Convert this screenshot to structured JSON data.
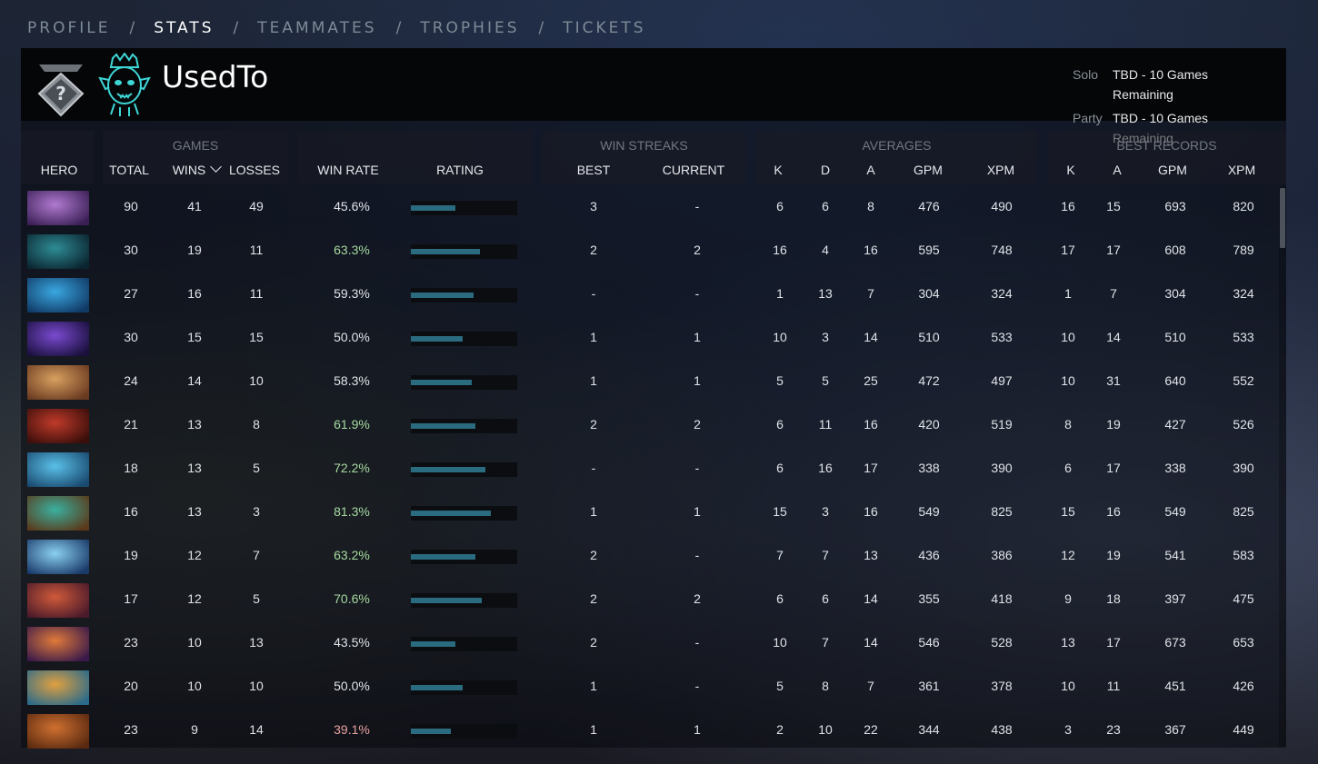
{
  "nav": {
    "tabs": [
      {
        "label": "PROFILE"
      },
      {
        "label": "STATS"
      },
      {
        "label": "TEAMMATES"
      },
      {
        "label": "TROPHIES"
      },
      {
        "label": "TICKETS"
      }
    ],
    "separator": "/",
    "active": "STATS"
  },
  "profile": {
    "username": "UsedTo",
    "rank_icon": "uncalibrated-rank-icon",
    "avatar_icon": "tribal-mask-avatar-icon",
    "mmr": [
      {
        "label": "Solo",
        "value": "TBD - 10 Games Remaining"
      },
      {
        "label": "Party",
        "value": "TBD - 10 Games Remaining"
      }
    ]
  },
  "headers": {
    "groups": {
      "games": "GAMES",
      "win_streaks": "WIN STREAKS",
      "averages": "AVERAGES",
      "best_records": "BEST RECORDS"
    },
    "columns": {
      "hero": "HERO",
      "total": "TOTAL",
      "wins": "WINS",
      "losses": "LOSSES",
      "win_rate": "WIN RATE",
      "rating": "RATING",
      "best": "BEST",
      "current": "CURRENT",
      "avg_k": "K",
      "avg_d": "D",
      "avg_a": "A",
      "avg_gpm": "GPM",
      "avg_xpm": "XPM",
      "best_k": "K",
      "best_a": "A",
      "best_gpm": "GPM",
      "best_xpm": "XPM"
    },
    "sort_icon": "chevron-down-icon"
  },
  "colors": {
    "win_good": "#a6d9a0",
    "win_neutral": "#dfe3e8",
    "win_bad": "#e8a0a0",
    "rating_bar": "#2b6b7f",
    "accent": "#ffffff"
  },
  "rows": [
    {
      "c1": "#b07ad0",
      "c2": "#3a1f55",
      "total": "90",
      "wins": "41",
      "losses": "49",
      "win_rate": "45.6%",
      "tone": "neutral",
      "rating": 0.42,
      "best": "3",
      "current": "-",
      "k": "6",
      "d": "6",
      "a": "8",
      "gpm": "476",
      "xpm": "490",
      "bk": "16",
      "ba": "15",
      "bgpm": "693",
      "bxpm": "820"
    },
    {
      "c1": "#2e8c95",
      "c2": "#0b2530",
      "total": "30",
      "wins": "19",
      "losses": "11",
      "win_rate": "63.3%",
      "tone": "good",
      "rating": 0.65,
      "best": "2",
      "current": "2",
      "k": "16",
      "d": "4",
      "a": "16",
      "gpm": "595",
      "xpm": "748",
      "bk": "17",
      "ba": "17",
      "bgpm": "608",
      "bxpm": "789"
    },
    {
      "c1": "#3aa7e0",
      "c2": "#103a66",
      "total": "27",
      "wins": "16",
      "losses": "11",
      "win_rate": "59.3%",
      "tone": "neutral",
      "rating": 0.59,
      "best": "-",
      "current": "-",
      "k": "1",
      "d": "13",
      "a": "7",
      "gpm": "304",
      "xpm": "324",
      "bk": "1",
      "ba": "7",
      "bgpm": "304",
      "bxpm": "324"
    },
    {
      "c1": "#7a4ad0",
      "c2": "#1a103d",
      "total": "30",
      "wins": "15",
      "losses": "15",
      "win_rate": "50.0%",
      "tone": "neutral",
      "rating": 0.49,
      "best": "1",
      "current": "1",
      "k": "10",
      "d": "3",
      "a": "14",
      "gpm": "510",
      "xpm": "533",
      "bk": "10",
      "ba": "14",
      "bgpm": "510",
      "bxpm": "533"
    },
    {
      "c1": "#d8a060",
      "c2": "#6a3a20",
      "total": "24",
      "wins": "14",
      "losses": "10",
      "win_rate": "58.3%",
      "tone": "neutral",
      "rating": 0.57,
      "best": "1",
      "current": "1",
      "k": "5",
      "d": "5",
      "a": "25",
      "gpm": "472",
      "xpm": "497",
      "bk": "10",
      "ba": "31",
      "bgpm": "640",
      "bxpm": "552"
    },
    {
      "c1": "#c03a2a",
      "c2": "#3a0e0a",
      "total": "21",
      "wins": "13",
      "losses": "8",
      "win_rate": "61.9%",
      "tone": "good",
      "rating": 0.61,
      "best": "2",
      "current": "2",
      "k": "6",
      "d": "11",
      "a": "16",
      "gpm": "420",
      "xpm": "519",
      "bk": "8",
      "ba": "19",
      "bgpm": "427",
      "bxpm": "526"
    },
    {
      "c1": "#5ac0e8",
      "c2": "#1a4a70",
      "total": "18",
      "wins": "13",
      "losses": "5",
      "win_rate": "72.2%",
      "tone": "good",
      "rating": 0.7,
      "best": "-",
      "current": "-",
      "k": "6",
      "d": "16",
      "a": "17",
      "gpm": "338",
      "xpm": "390",
      "bk": "6",
      "ba": "17",
      "bgpm": "338",
      "bxpm": "390"
    },
    {
      "c1": "#3ab0a0",
      "c2": "#5a3a1a",
      "total": "16",
      "wins": "13",
      "losses": "3",
      "win_rate": "81.3%",
      "tone": "good",
      "rating": 0.75,
      "best": "1",
      "current": "1",
      "k": "15",
      "d": "3",
      "a": "16",
      "gpm": "549",
      "xpm": "825",
      "bk": "15",
      "ba": "16",
      "bgpm": "549",
      "bxpm": "825"
    },
    {
      "c1": "#8ad0f0",
      "c2": "#1a3a6a",
      "total": "19",
      "wins": "12",
      "losses": "7",
      "win_rate": "63.2%",
      "tone": "good",
      "rating": 0.61,
      "best": "2",
      "current": "-",
      "k": "7",
      "d": "7",
      "a": "13",
      "gpm": "436",
      "xpm": "386",
      "bk": "12",
      "ba": "19",
      "bgpm": "541",
      "bxpm": "583"
    },
    {
      "c1": "#d05a3a",
      "c2": "#4a1a2a",
      "total": "17",
      "wins": "12",
      "losses": "5",
      "win_rate": "70.6%",
      "tone": "good",
      "rating": 0.67,
      "best": "2",
      "current": "2",
      "k": "6",
      "d": "6",
      "a": "14",
      "gpm": "355",
      "xpm": "418",
      "bk": "9",
      "ba": "18",
      "bgpm": "397",
      "bxpm": "475"
    },
    {
      "c1": "#e07a3a",
      "c2": "#3a1a4a",
      "total": "23",
      "wins": "10",
      "losses": "13",
      "win_rate": "43.5%",
      "tone": "neutral",
      "rating": 0.42,
      "best": "2",
      "current": "-",
      "k": "10",
      "d": "7",
      "a": "14",
      "gpm": "546",
      "xpm": "528",
      "bk": "13",
      "ba": "17",
      "bgpm": "673",
      "bxpm": "653"
    },
    {
      "c1": "#e0a040",
      "c2": "#2a6a8a",
      "total": "20",
      "wins": "10",
      "losses": "10",
      "win_rate": "50.0%",
      "tone": "neutral",
      "rating": 0.49,
      "best": "1",
      "current": "-",
      "k": "5",
      "d": "8",
      "a": "7",
      "gpm": "361",
      "xpm": "378",
      "bk": "10",
      "ba": "11",
      "bgpm": "451",
      "bxpm": "426"
    },
    {
      "c1": "#d07030",
      "c2": "#5a2a10",
      "total": "23",
      "wins": "9",
      "losses": "14",
      "win_rate": "39.1%",
      "tone": "bad",
      "rating": 0.38,
      "best": "1",
      "current": "1",
      "k": "2",
      "d": "10",
      "a": "22",
      "gpm": "344",
      "xpm": "438",
      "bk": "3",
      "ba": "23",
      "bgpm": "367",
      "bxpm": "449"
    }
  ]
}
